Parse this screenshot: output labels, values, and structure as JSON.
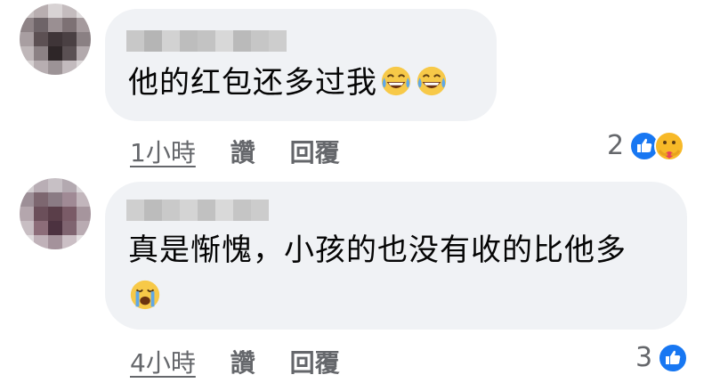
{
  "comments": [
    {
      "text": "他的红包还多过我",
      "emojis": [
        "face-with-tears-of-joy",
        "face-with-tears-of-joy"
      ],
      "time": "1小時",
      "like_label": "讚",
      "reply_label": "回覆",
      "reaction_count": "2",
      "reactions": [
        "like",
        "care"
      ]
    },
    {
      "text_line1": "真是惭愧，小孩的也没有收的比他多",
      "emojis": [
        "loudly-crying-face"
      ],
      "time": "4小時",
      "like_label": "讚",
      "reply_label": "回覆",
      "reaction_count": "3",
      "reactions": [
        "like"
      ]
    }
  ],
  "colors": {
    "bubble": "#f0f2f5",
    "meta_text": "#65676b",
    "like_blue": "#1877f2",
    "care_yellow": "#f7b928"
  }
}
